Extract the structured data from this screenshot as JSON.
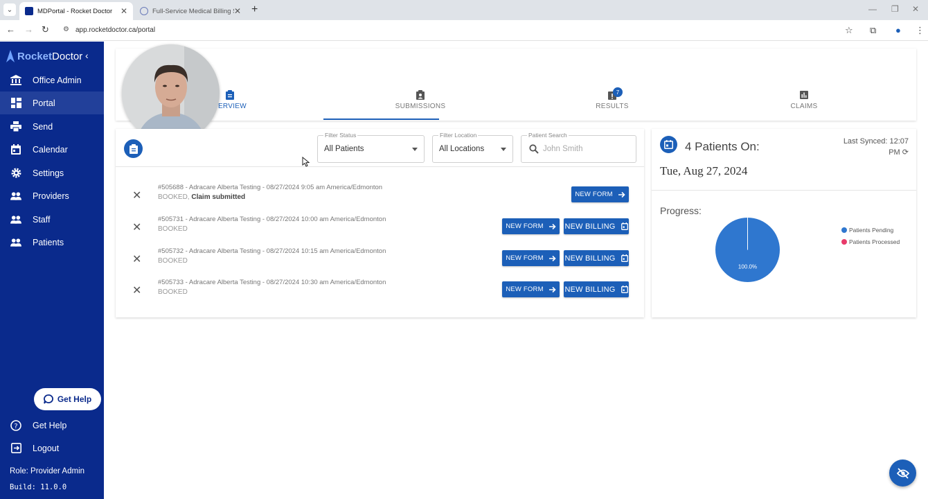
{
  "browser": {
    "tabs": [
      {
        "title": "MDPortal - Rocket Doctor",
        "active": true
      },
      {
        "title": "Full-Service Medical Billing Software",
        "active": false
      }
    ],
    "url": "app.rocketdoctor.ca/portal"
  },
  "sidebar": {
    "logo": {
      "part1": "Rocket",
      "part2": "Doctor"
    },
    "items": [
      {
        "label": "Office Admin",
        "icon": "bank-icon"
      },
      {
        "label": "Portal",
        "icon": "dashboard-icon",
        "active": true
      },
      {
        "label": "Send",
        "icon": "printer-icon"
      },
      {
        "label": "Calendar",
        "icon": "calendar-icon"
      },
      {
        "label": "Settings",
        "icon": "gear-icon"
      },
      {
        "label": "Providers",
        "icon": "people-icon"
      },
      {
        "label": "Staff",
        "icon": "people-icon"
      },
      {
        "label": "Patients",
        "icon": "people-icon"
      }
    ],
    "help_button": "Get Help",
    "bottom_items": [
      {
        "label": "Get Help",
        "icon": "help-icon"
      },
      {
        "label": "Logout",
        "icon": "logout-icon"
      }
    ],
    "role": "Role: Provider Admin",
    "build": "Build: 11.0.0"
  },
  "main_tabs": [
    {
      "label": "VERVIEW",
      "icon": "clipboard-icon",
      "active": true
    },
    {
      "label": "SUBMISSIONS",
      "icon": "assignment-ind-icon"
    },
    {
      "label": "RESULTS",
      "icon": "alert-clipboard-icon",
      "badge": "7"
    },
    {
      "label": "CLAIMS",
      "icon": "bar-chart-icon"
    }
  ],
  "filters": {
    "status": {
      "label": "Filter Status",
      "value": "All Patients"
    },
    "location": {
      "label": "Filter Location",
      "value": "All Locations"
    },
    "search": {
      "label": "Patient Search",
      "placeholder": "John Smith"
    }
  },
  "appointments": [
    {
      "line1": "#505688 - Adracare Alberta Testing - 08/27/2024 9:05 am America/Edmonton",
      "status": "BOOKED",
      "extra": "Claim submitted",
      "buttons": [
        "NEW FORM"
      ]
    },
    {
      "line1": "#505731 - Adracare Alberta Testing - 08/27/2024 10:00 am America/Edmonton",
      "status": "BOOKED",
      "extra": "",
      "buttons": [
        "NEW FORM",
        "NEW BILLING"
      ]
    },
    {
      "line1": "#505732 - Adracare Alberta Testing - 08/27/2024 10:15 am America/Edmonton",
      "status": "BOOKED",
      "extra": "",
      "buttons": [
        "NEW FORM",
        "NEW BILLING"
      ]
    },
    {
      "line1": "#505733 - Adracare Alberta Testing - 08/27/2024 10:30 am America/Edmonton",
      "status": "BOOKED",
      "extra": "",
      "buttons": [
        "NEW FORM",
        "NEW BILLING"
      ]
    }
  ],
  "summary": {
    "count_text": "4 Patients On:",
    "last_synced": "Last Synced: 12:07 PM",
    "date": "Tue, Aug 27, 2024",
    "progress_label": "Progress:",
    "pie_label": "100.0%"
  },
  "chart_data": {
    "type": "pie",
    "labels": [
      "Patients Pending",
      "Patients Processed"
    ],
    "values": [
      100.0,
      0.0
    ],
    "colors": [
      "#2f77cf",
      "#e83a6a"
    ],
    "legend": "right"
  },
  "colors": {
    "sidebar": "#0a2a8c",
    "accent": "#1c5fb8"
  }
}
